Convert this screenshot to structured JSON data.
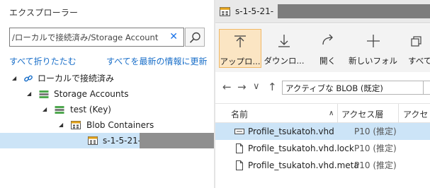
{
  "explorer": {
    "title": "エクスプローラー",
    "search": {
      "value": "",
      "placeholder": "/ローカルで接続済み/Storage Account"
    },
    "clear_icon": "✕",
    "links": {
      "collapse_all": "すべて折りたたむ",
      "refresh_all": "すべてを最新の情報に更新"
    },
    "tree": [
      {
        "label": "ローカルで接続済み",
        "icon": "link-icon"
      },
      {
        "label": "Storage Accounts",
        "icon": "storage-accounts-icon"
      },
      {
        "label": "test (Key)",
        "icon": "storage-account-icon"
      },
      {
        "label": "Blob Containers",
        "icon": "blob-containers-icon"
      },
      {
        "label": "s-1-5-21-",
        "icon": "container-icon",
        "selected": true
      }
    ]
  },
  "editor": {
    "tab_label": "s-1-5-21-",
    "toolbar": [
      {
        "label": "アップロ...",
        "icon": "upload-icon"
      },
      {
        "label": "ダウンロ...",
        "icon": "download-icon"
      },
      {
        "label": "開く",
        "icon": "open-icon"
      },
      {
        "label": "新しいフォル...",
        "icon": "new-folder-icon"
      },
      {
        "label": "すべて",
        "icon": "select-all-icon"
      }
    ],
    "nav": {
      "back": "←",
      "forward": "→",
      "dropdown": "∨",
      "up": "↑",
      "view_value": "アクティブな BLOB (既定)"
    },
    "columns": {
      "name": "名前",
      "sort_indicator": "∧",
      "access_tier": "アクセス層",
      "access_tier_2": "アクセ"
    },
    "rows": [
      {
        "name": "Profile_tsukatoh.vhd",
        "tier": "P10 (推定)",
        "icon": "disk-file-icon",
        "selected": true
      },
      {
        "name": "Profile_tsukatoh.vhd.lock",
        "tier": "P10 (推定)",
        "icon": "file-icon"
      },
      {
        "name": "Profile_tsukatoh.vhd.meta",
        "tier": "P10 (推定)",
        "icon": "file-icon"
      }
    ]
  },
  "colors": {
    "accent": "#1a6fc9",
    "selection": "#cce4f7",
    "active_button": "#fbe5c3",
    "storage_green": "#4fa84f"
  }
}
